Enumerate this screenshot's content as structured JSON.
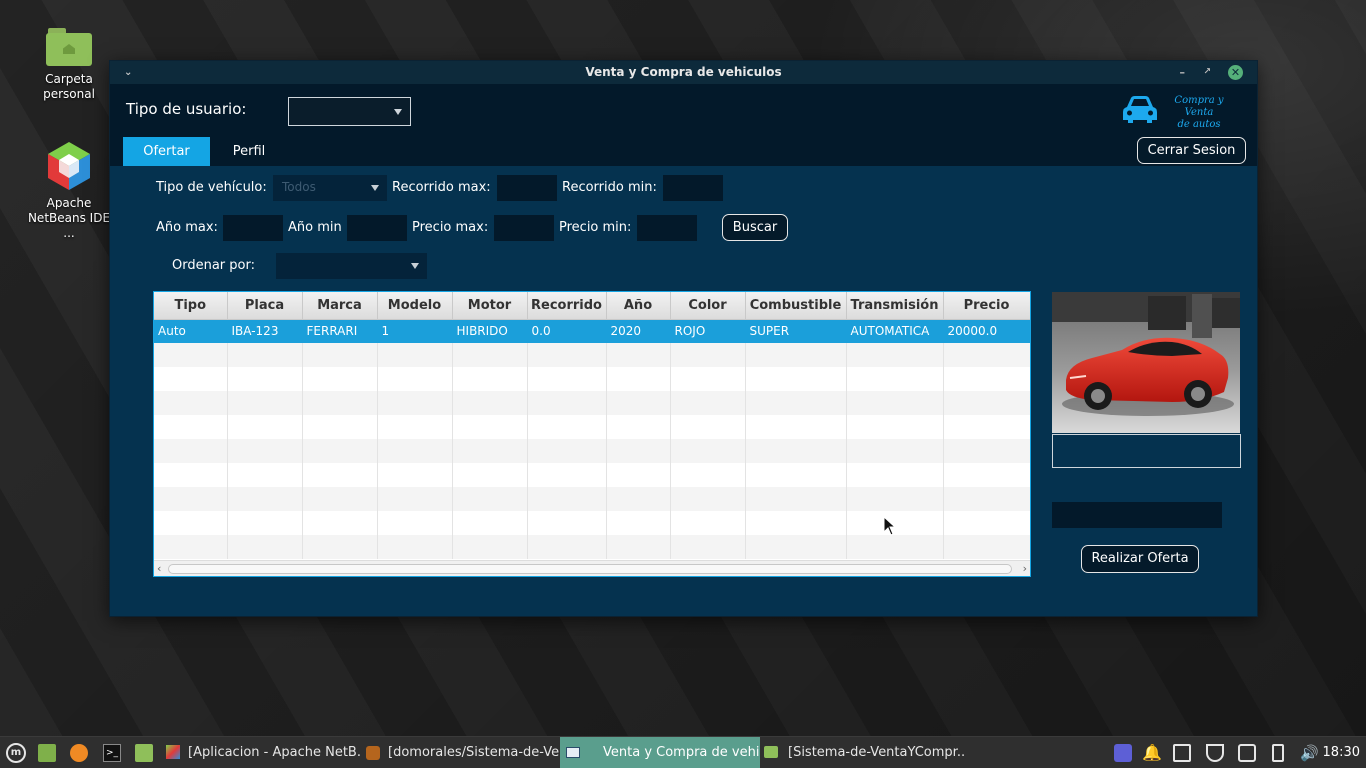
{
  "desktop": {
    "icons": [
      {
        "label_line1": "Carpeta",
        "label_line2": "personal",
        "icon": "home-folder-icon"
      },
      {
        "label_line1": "Apache",
        "label_line2": "NetBeans IDE ...",
        "icon": "netbeans-icon"
      }
    ]
  },
  "window": {
    "title": "Venta y Compra de vehiculos",
    "user_type_label": "Tipo de usuario:",
    "user_type_value": "",
    "logo_line1": "Compra y Venta",
    "logo_line2": "de autos",
    "tabs": [
      {
        "label": "Ofertar",
        "active": true
      },
      {
        "label": "Perfil",
        "active": false
      }
    ],
    "logout_label": "Cerrar Sesion",
    "filters": {
      "vehicle_type_label": "Tipo de vehículo:",
      "vehicle_type_value": "Todos",
      "mileage_max_label": "Recorrido max:",
      "mileage_min_label": "Recorrido min:",
      "year_max_label": "Año max:",
      "year_min_label": "Año min",
      "price_max_label": "Precio max:",
      "price_min_label": "Precio min:",
      "search_label": "Buscar",
      "sort_label": "Ordenar por:",
      "sort_value": ""
    },
    "table": {
      "columns": [
        "Tipo",
        "Placa",
        "Marca",
        "Modelo",
        "Motor",
        "Recorrido",
        "Año",
        "Color",
        "Combustible",
        "Transmisión",
        "Precio"
      ],
      "rows": [
        [
          "Auto",
          "IBA-123",
          "FERRARI",
          "1",
          "HIBRIDO",
          "0.0",
          "2020",
          "ROJO",
          "SUPER",
          "AUTOMATICA",
          "20000.0"
        ]
      ],
      "empty_rows": 9
    },
    "offer_button_label": "Realizar Oferta"
  },
  "taskbar": {
    "items": [
      {
        "label": "[Aplicacion - Apache NetB...",
        "active": false
      },
      {
        "label": "[domorales/Sistema-de-Ve...",
        "active": false
      },
      {
        "label": "Venta y Compra de vehi...",
        "active": true
      },
      {
        "label": "[Sistema-de-VentaYCompr...",
        "active": false
      }
    ],
    "clock": "18:30"
  },
  "colors": {
    "window_bg": "#05324f",
    "topbar_bg": "#03192a",
    "accent": "#14a5e4",
    "selected_row": "#1b9fda",
    "car_red": "#d6261c"
  }
}
